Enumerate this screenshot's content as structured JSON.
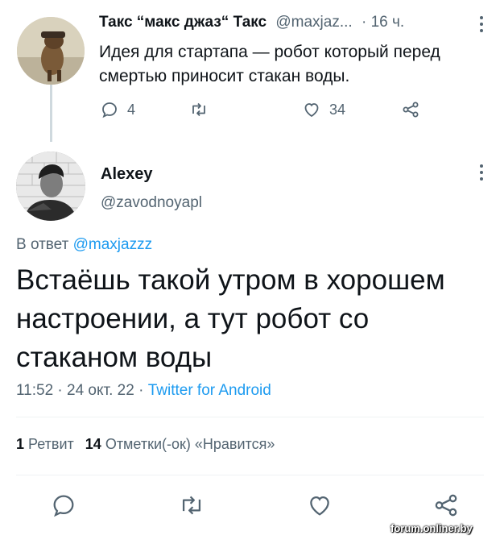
{
  "tweet": {
    "author_name": "Такс “макс джаз“ Такс",
    "author_handle": "@maxjaz...",
    "time": "· 16 ч.",
    "text": "Идея для стартапа — робот который перед смертью приносит стакан воды.",
    "replies": "4",
    "retweets": "",
    "likes": "34"
  },
  "reply": {
    "author_name": "Alexey",
    "author_handle": "@zavodnoyapl",
    "reply_to_label": "В ответ",
    "reply_to_handle": "@maxjazzz",
    "text": "Встаёшь такой утром в хорошем настроении, а тут робот со стаканом воды",
    "timestamp": "11:52 · 24 окт. 22 · ",
    "source": "Twitter for Android",
    "retweet_count": "1",
    "retweet_label": "Ретвит",
    "like_count": "14",
    "like_label": "Отметки(-ок) «Нравится»"
  },
  "icons": {
    "reply": "comment-icon",
    "retweet": "retweet-icon",
    "like": "heart-icon",
    "share": "share-icon",
    "more": "more-vertical-icon"
  },
  "colors": {
    "accent": "#1d9bf0",
    "muted": "#536471",
    "text": "#0f1419"
  },
  "watermark": "forum.onliner.by"
}
